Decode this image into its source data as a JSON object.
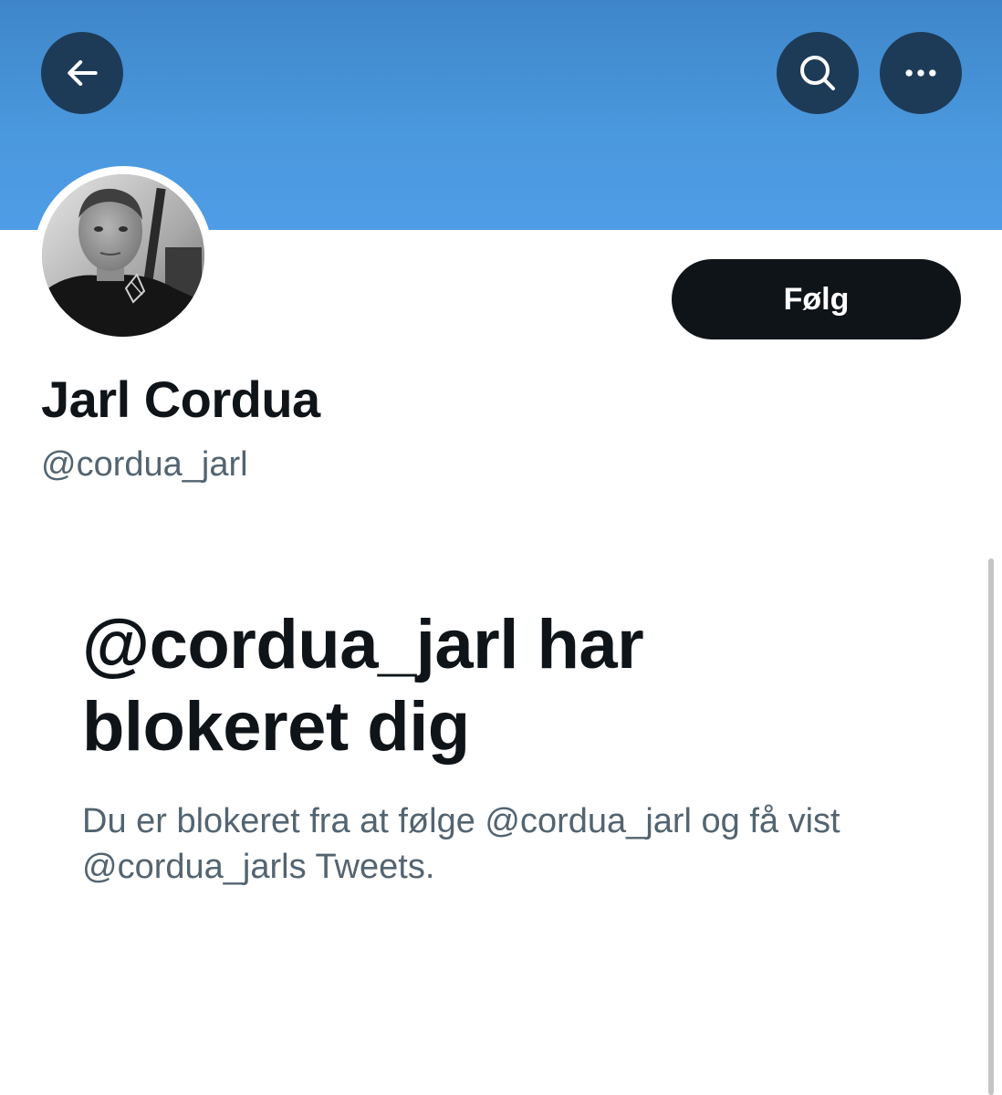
{
  "header": {
    "back_icon": "arrow-left-icon",
    "search_icon": "search-icon",
    "more_icon": "more-horizontal-icon",
    "banner_color": "#4a97dd",
    "button_color": "#1d3b57"
  },
  "profile": {
    "display_name": "Jarl Cordua",
    "handle": "@cordua_jarl",
    "follow_label": "Følg",
    "avatar": "profile-photo"
  },
  "blocked": {
    "title": "@cordua_jarl har blokeret dig",
    "description": "Du er blokeret fra at følge @cordua_jarl og få vist @cordua_jarls Tweets."
  }
}
